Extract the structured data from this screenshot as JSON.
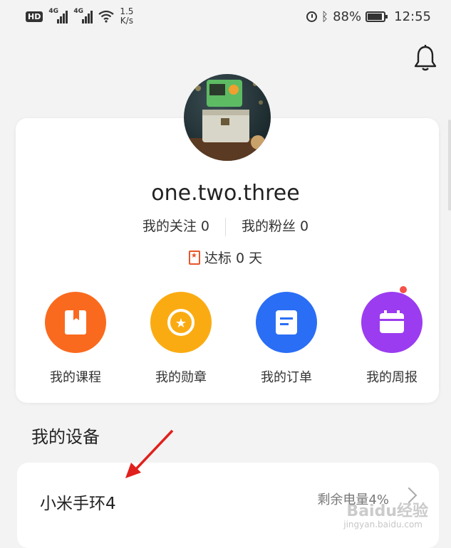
{
  "status_bar": {
    "hd": "HD",
    "net1": "4G",
    "net2": "4G",
    "speed_value": "1.5",
    "speed_unit": "K/s",
    "battery": "88%",
    "time": "12:55",
    "icons": [
      "alarm-icon",
      "bluetooth-icon",
      "battery-icon",
      "wifi-icon",
      "signal-icon"
    ]
  },
  "profile": {
    "username": "one.two.three",
    "following": "我的关注 0",
    "followers": "我的粉丝 0",
    "target": "达标 0 天"
  },
  "features": [
    {
      "label": "我的课程",
      "color": "#fa6a1e",
      "icon": "book-icon"
    },
    {
      "label": "我的勋章",
      "color": "#fbab12",
      "icon": "medal-icon"
    },
    {
      "label": "我的订单",
      "color": "#2a6ef5",
      "icon": "order-icon"
    },
    {
      "label": "我的周报",
      "color": "#9b3cf0",
      "icon": "report-icon",
      "has_dot": true
    }
  ],
  "devices": {
    "title": "我的设备",
    "items": [
      {
        "name": "小米手环4",
        "battery": "剩余电量4%"
      }
    ]
  },
  "watermark": {
    "text": "Baidu经验",
    "url": "jingyan.baidu.com"
  },
  "colors": {
    "background": "#f3f3f3",
    "card": "#ffffff",
    "arrow": "#e0201c",
    "notification_dot": "#f5524a"
  }
}
